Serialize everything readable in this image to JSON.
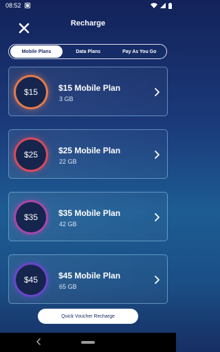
{
  "status_bar": {
    "time": "08:52",
    "icons": [
      "screenshot-icon",
      "wifi-icon",
      "signal-icon",
      "battery-icon"
    ]
  },
  "header": {
    "title": "Recharge",
    "close_icon": "close-icon"
  },
  "tabs": [
    {
      "label": "Mobile Plans",
      "active": true
    },
    {
      "label": "Data Plans",
      "active": false
    },
    {
      "label": "Pay As You Go",
      "active": false
    }
  ],
  "plans": [
    {
      "price": "$15",
      "name": "$15 Mobile Plan",
      "data": "3 GB",
      "ring_color": "#e57a4a"
    },
    {
      "price": "$25",
      "name": "$25 Mobile Plan",
      "data": "22 GB",
      "ring_color": "#d94a5b"
    },
    {
      "price": "$35",
      "name": "$35 Mobile Plan",
      "data": "42 GB",
      "ring_color": "#a847a8"
    },
    {
      "price": "$45",
      "name": "$45 Mobile Plan",
      "data": "65 GB",
      "ring_color": "#6a45c9"
    }
  ],
  "voucher_button": {
    "label": "Quick Voucher Recharge"
  },
  "colors": {
    "accent_text": "#1a2b63",
    "background_top": "#13225a",
    "background_mid": "#1d5c93"
  }
}
